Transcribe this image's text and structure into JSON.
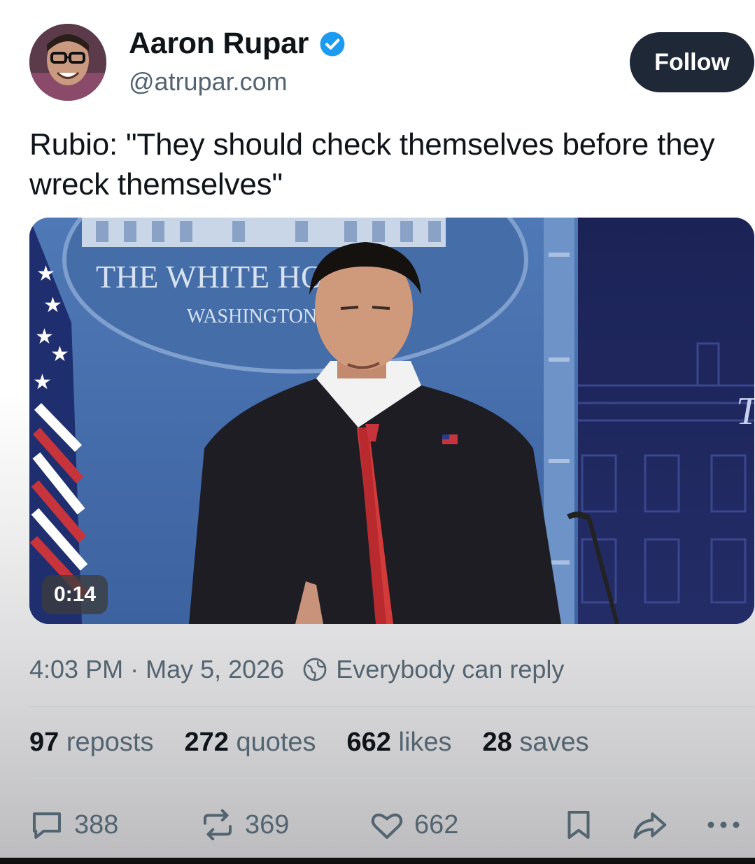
{
  "author": {
    "name": "Aaron Rupar",
    "handle": "@atrupar.com",
    "verified": true,
    "avatar_icon": "user-avatar"
  },
  "follow_label": "Follow",
  "post": {
    "text": "Rubio: \"They should check themselves before they wreck themselves\""
  },
  "media": {
    "type": "video",
    "duration": "0:14",
    "seal_line1": "THE WHITE HOUSE",
    "seal_line2": "WASHINGTON",
    "backdrop_letter": "T"
  },
  "meta": {
    "time": "4:03 PM",
    "separator": " · ",
    "date": "May 5, 2026",
    "reply_permission": "Everybody can reply"
  },
  "stats": [
    {
      "count": "97",
      "label": "reposts"
    },
    {
      "count": "272",
      "label": "quotes"
    },
    {
      "count": "662",
      "label": "likes"
    },
    {
      "count": "28",
      "label": "saves"
    }
  ],
  "actions": {
    "reply_count": "388",
    "repost_count": "369",
    "like_count": "662"
  },
  "colors": {
    "follow_button": "#1f2836",
    "verified_badge": "#1d9bf0",
    "secondary_text": "#536471"
  }
}
